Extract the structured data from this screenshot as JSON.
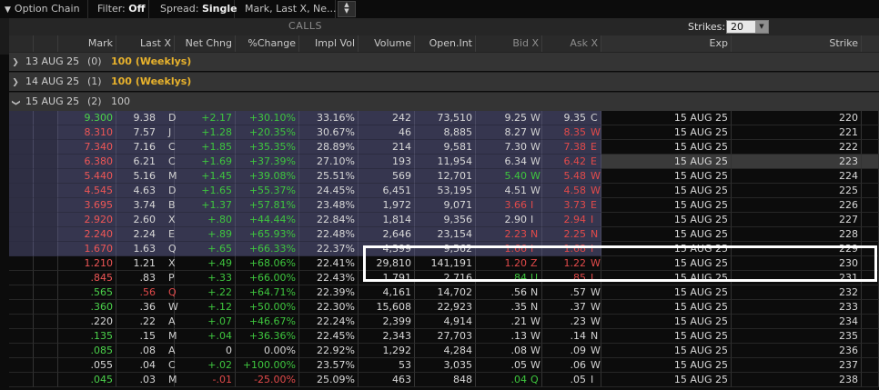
{
  "toolbar": {
    "title": "Option Chain",
    "filter_label": "Filter:",
    "filter_value": "Off",
    "spread_label": "Spread:",
    "spread_value": "Single",
    "layout_value": "Mark, Last X, Ne..."
  },
  "header": {
    "calls_label": "CALLS",
    "strikes_label": "Strikes:",
    "strikes_value": "20",
    "columns": {
      "mark": "Mark",
      "last": "Last X",
      "net": "Net Chng",
      "pct": "%Change",
      "iv": "Impl Vol",
      "volume": "Volume",
      "oi": "Open.Int",
      "bid": "Bid X",
      "ask": "Ask X",
      "exp": "Exp",
      "strike": "Strike"
    }
  },
  "expirations": [
    {
      "date": "13 AUG 25",
      "count": "(0)",
      "multiplier": "100",
      "tag": "(Weeklys)",
      "expanded": false
    },
    {
      "date": "14 AUG 25",
      "count": "(1)",
      "multiplier": "100",
      "tag": "(Weeklys)",
      "expanded": false
    },
    {
      "date": "15 AUG 25",
      "count": "(2)",
      "multiplier": "100",
      "tag": "",
      "expanded": true
    }
  ],
  "rows": [
    {
      "mark": "9.300",
      "last": "9.38",
      "lx": "D",
      "net": "+2.17",
      "pct": "+30.10%",
      "iv": "33.16%",
      "vol": "242",
      "oi": "73,510",
      "bid": "9.25",
      "bx": "W",
      "ask": "9.35",
      "ax": "C",
      "exp": "15 AUG 25",
      "strike": "220",
      "itm": true,
      "dir": "up"
    },
    {
      "mark": "8.310",
      "last": "7.57",
      "lx": "J",
      "net": "+1.28",
      "pct": "+20.35%",
      "iv": "30.67%",
      "vol": "46",
      "oi": "8,885",
      "bid": "8.27",
      "bx": "W",
      "ask": "8.35",
      "ax": "W",
      "exp": "15 AUG 25",
      "strike": "221",
      "itm": true,
      "dir": "down"
    },
    {
      "mark": "7.340",
      "last": "7.16",
      "lx": "C",
      "net": "+1.85",
      "pct": "+35.35%",
      "iv": "28.89%",
      "vol": "214",
      "oi": "9,581",
      "bid": "7.30",
      "bx": "W",
      "ask": "7.38",
      "ax": "E",
      "exp": "15 AUG 25",
      "strike": "222",
      "itm": true,
      "dir": "down"
    },
    {
      "mark": "6.380",
      "last": "6.21",
      "lx": "C",
      "net": "+1.69",
      "pct": "+37.39%",
      "iv": "27.10%",
      "vol": "193",
      "oi": "11,954",
      "bid": "6.34",
      "bx": "W",
      "ask": "6.42",
      "ax": "E",
      "exp": "15 AUG 25",
      "strike": "223",
      "itm": true,
      "dir": "down",
      "atm": true
    },
    {
      "mark": "5.440",
      "last": "5.16",
      "lx": "M",
      "net": "+1.45",
      "pct": "+39.08%",
      "iv": "25.51%",
      "vol": "569",
      "oi": "12,701",
      "bid": "5.40",
      "bx": "W",
      "ask": "5.48",
      "ax": "W",
      "exp": "15 AUG 25",
      "strike": "224",
      "itm": true,
      "dir": "down",
      "bid_up": true
    },
    {
      "mark": "4.545",
      "last": "4.63",
      "lx": "D",
      "net": "+1.65",
      "pct": "+55.37%",
      "iv": "24.45%",
      "vol": "6,451",
      "oi": "53,195",
      "bid": "4.51",
      "bx": "W",
      "ask": "4.58",
      "ax": "W",
      "exp": "15 AUG 25",
      "strike": "225",
      "itm": true,
      "dir": "down"
    },
    {
      "mark": "3.695",
      "last": "3.74",
      "lx": "B",
      "net": "+1.37",
      "pct": "+57.81%",
      "iv": "23.48%",
      "vol": "1,972",
      "oi": "9,071",
      "bid": "3.66",
      "bx": "I",
      "ask": "3.73",
      "ax": "E",
      "exp": "15 AUG 25",
      "strike": "226",
      "itm": true,
      "dir": "down",
      "bid_dn": true
    },
    {
      "mark": "2.920",
      "last": "2.60",
      "lx": "X",
      "net": "+.80",
      "pct": "+44.44%",
      "iv": "22.84%",
      "vol": "1,814",
      "oi": "9,356",
      "bid": "2.90",
      "bx": "I",
      "ask": "2.94",
      "ax": "I",
      "exp": "15 AUG 25",
      "strike": "227",
      "itm": true,
      "dir": "down"
    },
    {
      "mark": "2.240",
      "last": "2.24",
      "lx": "E",
      "net": "+.89",
      "pct": "+65.93%",
      "iv": "22.48%",
      "vol": "2,646",
      "oi": "23,154",
      "bid": "2.23",
      "bx": "N",
      "ask": "2.25",
      "ax": "N",
      "exp": "15 AUG 25",
      "strike": "228",
      "itm": true,
      "dir": "down",
      "bid_dn": true
    },
    {
      "mark": "1.670",
      "last": "1.63",
      "lx": "Q",
      "net": "+.65",
      "pct": "+66.33%",
      "iv": "22.37%",
      "vol": "4,399",
      "oi": "9,562",
      "bid": "1.66",
      "bx": "I",
      "ask": "1.68",
      "ax": "I",
      "exp": "15 AUG 25",
      "strike": "229",
      "itm": true,
      "dir": "down",
      "bid_dn": true
    },
    {
      "mark": "1.210",
      "last": "1.21",
      "lx": "X",
      "net": "+.49",
      "pct": "+68.06%",
      "iv": "22.41%",
      "vol": "29,810",
      "oi": "141,191",
      "bid": "1.20",
      "bx": "Z",
      "ask": "1.22",
      "ax": "W",
      "exp": "15 AUG 25",
      "strike": "230",
      "itm": false,
      "dir": "down",
      "bid_dn": true
    },
    {
      "mark": ".845",
      "last": ".83",
      "lx": "P",
      "net": "+.33",
      "pct": "+66.00%",
      "iv": "22.43%",
      "vol": "1,791",
      "oi": "2,716",
      "bid": ".84",
      "bx": "U",
      "ask": ".85",
      "ax": "I",
      "exp": "15 AUG 25",
      "strike": "231",
      "itm": false,
      "dir": "down",
      "bid_up": true
    },
    {
      "mark": ".565",
      "last": ".56",
      "lx": "Q",
      "net": "+.22",
      "pct": "+64.71%",
      "iv": "22.39%",
      "vol": "4,161",
      "oi": "14,702",
      "bid": ".56",
      "bx": "N",
      "ask": ".57",
      "ax": "W",
      "exp": "15 AUG 25",
      "strike": "232",
      "itm": false,
      "dir": "up",
      "last_dn": true
    },
    {
      "mark": ".360",
      "last": ".36",
      "lx": "W",
      "net": "+.12",
      "pct": "+50.00%",
      "iv": "22.30%",
      "vol": "15,608",
      "oi": "22,923",
      "bid": ".35",
      "bx": "N",
      "ask": ".37",
      "ax": "W",
      "exp": "15 AUG 25",
      "strike": "233",
      "itm": false,
      "dir": "up"
    },
    {
      "mark": ".220",
      "last": ".22",
      "lx": "A",
      "net": "+.07",
      "pct": "+46.67%",
      "iv": "22.24%",
      "vol": "2,399",
      "oi": "4,914",
      "bid": ".21",
      "bx": "W",
      "ask": ".23",
      "ax": "W",
      "exp": "15 AUG 25",
      "strike": "234",
      "itm": false,
      "dir": "neutral"
    },
    {
      "mark": ".135",
      "last": ".15",
      "lx": "M",
      "net": "+.04",
      "pct": "+36.36%",
      "iv": "22.45%",
      "vol": "2,343",
      "oi": "27,703",
      "bid": ".13",
      "bx": "W",
      "ask": ".14",
      "ax": "N",
      "exp": "15 AUG 25",
      "strike": "235",
      "itm": false,
      "dir": "up"
    },
    {
      "mark": ".085",
      "last": ".08",
      "lx": "A",
      "net": "0",
      "pct": "0.00%",
      "iv": "22.92%",
      "vol": "1,292",
      "oi": "4,284",
      "bid": ".08",
      "bx": "W",
      "ask": ".09",
      "ax": "W",
      "exp": "15 AUG 25",
      "strike": "236",
      "itm": false,
      "dir": "up",
      "flat": true
    },
    {
      "mark": ".055",
      "last": ".04",
      "lx": "C",
      "net": "+.02",
      "pct": "+100.00%",
      "iv": "23.57%",
      "vol": "53",
      "oi": "3,035",
      "bid": ".05",
      "bx": "W",
      "ask": ".06",
      "ax": "W",
      "exp": "15 AUG 25",
      "strike": "237",
      "itm": false,
      "dir": "neutral"
    },
    {
      "mark": ".045",
      "last": ".03",
      "lx": "M",
      "net": "-.01",
      "pct": "-25.00%",
      "iv": "25.09%",
      "vol": "463",
      "oi": "848",
      "bid": ".04",
      "bx": "Q",
      "ask": ".05",
      "ax": "I",
      "exp": "15 AUG 25",
      "strike": "238",
      "itm": false,
      "dir": "up",
      "neg": true,
      "bid_up": true
    }
  ],
  "colors": {
    "up": "#3ec63e",
    "down": "#e24a4a",
    "itm_bg": "#36364f",
    "weeklys": "#e8b22c"
  }
}
